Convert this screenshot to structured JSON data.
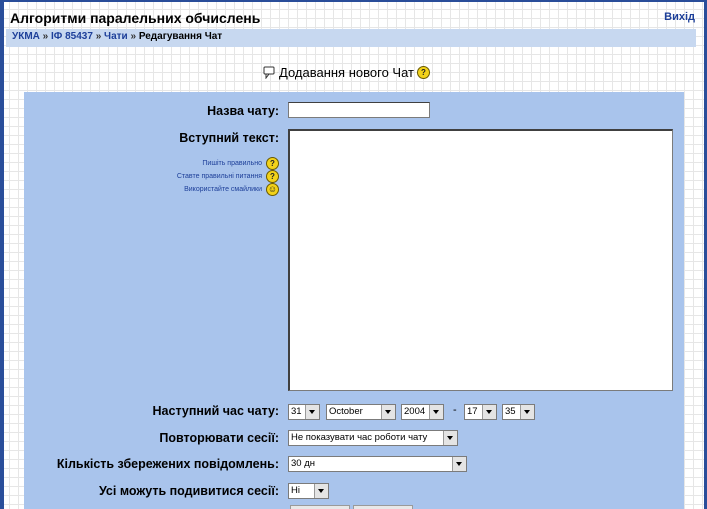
{
  "header": {
    "course_title": "Алгоритми паралельних обчислень",
    "logout": "Вихід"
  },
  "breadcrumb": {
    "home": "УКМА",
    "sep1": "»",
    "course": "ІФ 85437",
    "sep2": "»",
    "module": "Чати",
    "sep3": "»",
    "current": "Редагування Чат"
  },
  "page": {
    "heading": "Додавання нового Чат"
  },
  "form": {
    "chat_name": {
      "label": "Назва чату:",
      "value": ""
    },
    "intro": {
      "label": "Вступний текст:",
      "value": ""
    },
    "help": {
      "read_carefully": "Пишіть правильно",
      "ask_questions": "Ставте правильні питання",
      "use_smilies": "Використайте смайлики"
    },
    "next_time": {
      "label": "Наступний час чату:",
      "day": "31",
      "month": "October",
      "year": "2004",
      "separator": "-",
      "hour": "17",
      "minute": "35"
    },
    "repeat": {
      "label": "Повторювати сесії:",
      "value": "Не показувати час роботи чату"
    },
    "keep_days": {
      "label": "Кількість збережених повідомлень:",
      "value": "30 дн"
    },
    "view_sessions": {
      "label": "Усі можуть подивитися сесії:",
      "value": "Ні"
    }
  }
}
